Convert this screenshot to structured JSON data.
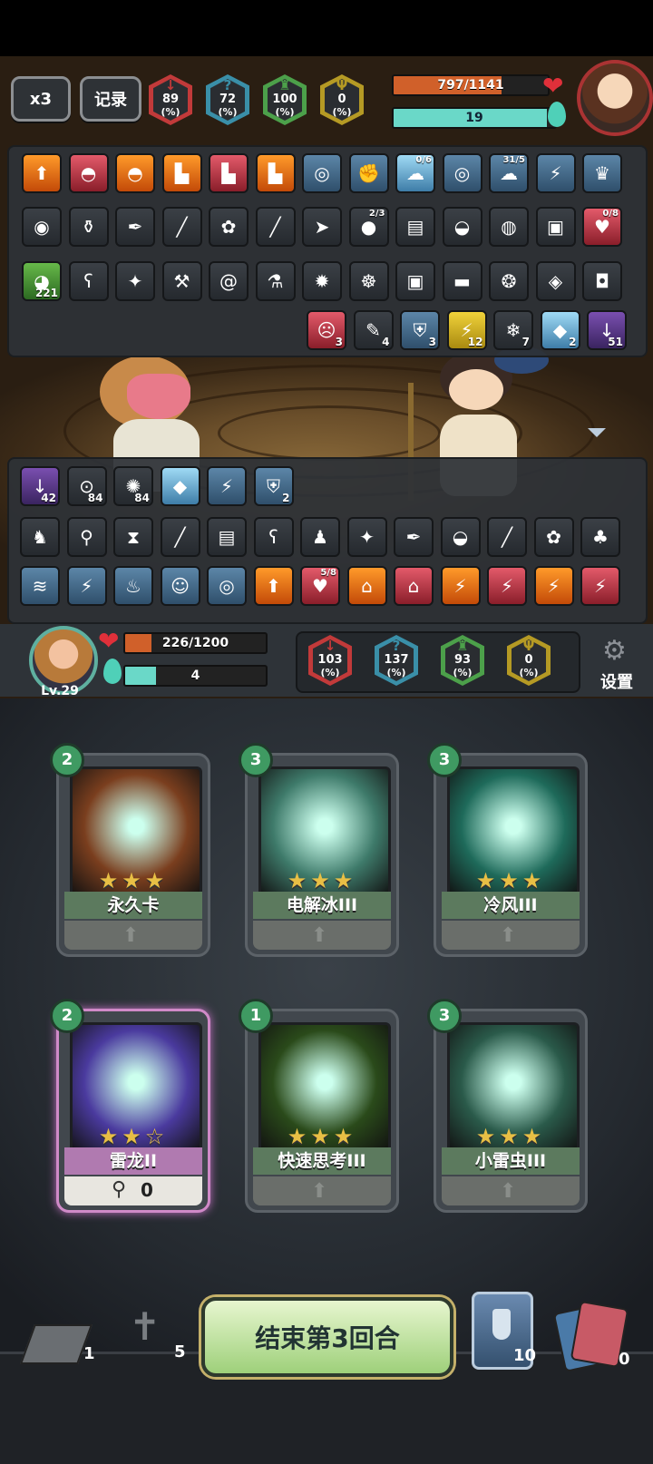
{
  "top_hud": {
    "speed": "x3",
    "record": "记录",
    "stats": [
      {
        "icon": "sword-down-icon",
        "value": "89",
        "unit": "(%)",
        "color": "#c23a3a"
      },
      {
        "icon": "question-icon",
        "value": "72",
        "unit": "(%)",
        "color": "#3a8fa8"
      },
      {
        "icon": "castle-icon",
        "value": "100",
        "unit": "(%)",
        "color": "#4ca04a"
      },
      {
        "icon": "trident-icon",
        "value": "0",
        "unit": "(%)",
        "color": "#b59a24"
      }
    ],
    "enemy_hp": "797/1141",
    "enemy_hp_fraction": 0.7,
    "enemy_energy": "19",
    "enemy_energy_fraction": 0.95
  },
  "enemy_panel": {
    "row1": [
      {
        "icon": "arrow-up-icon",
        "tone": "orange"
      },
      {
        "icon": "hat-icon",
        "tone": "red"
      },
      {
        "icon": "hat-icon",
        "tone": "orange"
      },
      {
        "icon": "boot-icon",
        "tone": "orange"
      },
      {
        "icon": "boot-icon",
        "tone": "red"
      },
      {
        "icon": "boot-icon",
        "tone": "orange"
      },
      {
        "icon": "swirl-icon",
        "tone": "blue"
      },
      {
        "icon": "muscle-icon",
        "tone": "blue"
      },
      {
        "icon": "cloud-icon",
        "tone": "ice",
        "top": "0/6"
      },
      {
        "icon": "swirl-icon",
        "tone": "blue"
      },
      {
        "icon": "cloud-icon",
        "tone": "blue",
        "top": "31/5"
      },
      {
        "icon": "lightning-icon",
        "tone": "blue"
      },
      {
        "icon": "crown-icon",
        "tone": "blue"
      }
    ],
    "row2": [
      {
        "icon": "goggles-icon",
        "tone": "dark"
      },
      {
        "icon": "bottle-icon",
        "tone": "dark"
      },
      {
        "icon": "feather-icon",
        "tone": "dark"
      },
      {
        "icon": "rod-icon",
        "tone": "dark"
      },
      {
        "icon": "creature-icon",
        "tone": "dark"
      },
      {
        "icon": "rod-icon",
        "tone": "dark"
      },
      {
        "icon": "fish-icon",
        "tone": "dark"
      },
      {
        "icon": "fruit-icon",
        "tone": "dark",
        "top": "2/3"
      },
      {
        "icon": "book-icon",
        "tone": "dark"
      },
      {
        "icon": "helmet-icon",
        "tone": "dark"
      },
      {
        "icon": "bag-icon",
        "tone": "dark"
      },
      {
        "icon": "robot-icon",
        "tone": "dark"
      },
      {
        "icon": "heart-shield-icon",
        "tone": "red",
        "top": "0/8"
      }
    ],
    "row3": [
      {
        "icon": "slime-icon",
        "tone": "green",
        "count": "221"
      },
      {
        "icon": "bear-icon",
        "tone": "dark"
      },
      {
        "icon": "beast-icon",
        "tone": "dark"
      },
      {
        "icon": "shovel-icon",
        "tone": "dark"
      },
      {
        "icon": "spiral-icon",
        "tone": "dark"
      },
      {
        "icon": "potion-icon",
        "tone": "dark"
      },
      {
        "icon": "bomb-icon",
        "tone": "dark"
      },
      {
        "icon": "ghost-icon",
        "tone": "dark"
      },
      {
        "icon": "robot-icon",
        "tone": "dark"
      },
      {
        "icon": "bread-icon",
        "tone": "dark"
      },
      {
        "icon": "wreath-icon",
        "tone": "dark"
      },
      {
        "icon": "orb-icon",
        "tone": "dark"
      },
      {
        "icon": "sack-icon",
        "tone": "dark"
      }
    ],
    "buffs": [
      {
        "icon": "angry-face-icon",
        "tone": "red",
        "count": "3"
      },
      {
        "icon": "brush-icon",
        "tone": "dark",
        "count": "4"
      },
      {
        "icon": "shield-icon",
        "tone": "blue",
        "count": "3"
      },
      {
        "icon": "lightning-icon",
        "tone": "yellow",
        "count": "12"
      },
      {
        "icon": "snowflake-icon",
        "tone": "dark",
        "count": "7"
      },
      {
        "icon": "ice-crystal-icon",
        "tone": "ice",
        "count": "2"
      },
      {
        "icon": "sword-down-icon",
        "tone": "purple",
        "count": "51"
      }
    ]
  },
  "player_panel": {
    "buffs": [
      {
        "icon": "sword-down-icon",
        "tone": "purple",
        "count": "42"
      },
      {
        "icon": "eyes-icon",
        "tone": "dark",
        "count": "84"
      },
      {
        "icon": "storm-icon",
        "tone": "dark",
        "count": "84"
      },
      {
        "icon": "ice-crystal-icon",
        "tone": "ice",
        "count": ""
      },
      {
        "icon": "lightning-icon",
        "tone": "blue",
        "count": ""
      },
      {
        "icon": "shield-icon",
        "tone": "blue",
        "count": "2"
      }
    ],
    "row2": [
      {
        "icon": "fighter-icon",
        "tone": "dark"
      },
      {
        "icon": "vial-icon",
        "tone": "dark"
      },
      {
        "icon": "hourglass-icon",
        "tone": "dark"
      },
      {
        "icon": "rod-icon",
        "tone": "dark"
      },
      {
        "icon": "book-icon",
        "tone": "dark"
      },
      {
        "icon": "bear-icon",
        "tone": "dark"
      },
      {
        "icon": "doll-icon",
        "tone": "dark"
      },
      {
        "icon": "beast-icon",
        "tone": "dark"
      },
      {
        "icon": "feather-icon",
        "tone": "dark"
      },
      {
        "icon": "helmet-icon",
        "tone": "dark"
      },
      {
        "icon": "rod-icon",
        "tone": "dark"
      },
      {
        "icon": "creature-icon",
        "tone": "dark"
      },
      {
        "icon": "plant-icon",
        "tone": "dark"
      }
    ],
    "row3": [
      {
        "icon": "wind-icon",
        "tone": "blue"
      },
      {
        "icon": "lightning-icon",
        "tone": "blue"
      },
      {
        "icon": "pig-icon",
        "tone": "blue"
      },
      {
        "icon": "face-icon",
        "tone": "blue"
      },
      {
        "icon": "swirl-icon",
        "tone": "blue"
      },
      {
        "icon": "arrow-up-icon",
        "tone": "orange"
      },
      {
        "icon": "heart-shield-icon",
        "tone": "red",
        "top": "5/8"
      },
      {
        "icon": "shirt-icon",
        "tone": "orange"
      },
      {
        "icon": "shirt-icon",
        "tone": "red"
      },
      {
        "icon": "lightning-icon",
        "tone": "orange"
      },
      {
        "icon": "lightning-icon",
        "tone": "red"
      },
      {
        "icon": "lightning-icon",
        "tone": "orange"
      },
      {
        "icon": "lightning-icon",
        "tone": "red"
      }
    ]
  },
  "player_hud": {
    "level": "Lv.29",
    "hp": "226/1200",
    "hp_fraction": 0.19,
    "energy": "4",
    "energy_fraction": 0.22,
    "stats": [
      {
        "icon": "sword-down-icon",
        "value": "103",
        "unit": "(%)",
        "color": "#c23a3a"
      },
      {
        "icon": "question-icon",
        "value": "137",
        "unit": "(%)",
        "color": "#3a8fa8"
      },
      {
        "icon": "castle-icon",
        "value": "93",
        "unit": "(%)",
        "color": "#4ca04a"
      },
      {
        "icon": "trident-icon",
        "value": "0",
        "unit": "(%)",
        "color": "#b59a24"
      }
    ],
    "settings": "设置"
  },
  "cards": [
    {
      "cost": "2",
      "name": "永久卡",
      "stars": "★★★",
      "art": "#7a3e1e",
      "name_bg": "#5c7a5e",
      "footer": ""
    },
    {
      "cost": "3",
      "name": "电解冰III",
      "stars": "★★★",
      "art": "#3e7a6a",
      "name_bg": "#5c7a5e",
      "footer": ""
    },
    {
      "cost": "3",
      "name": "冷风III",
      "stars": "★★★",
      "art": "#1e6a5a",
      "name_bg": "#5c7a5e",
      "footer": ""
    },
    {
      "cost": "2",
      "name": "雷龙II",
      "stars": "★★☆",
      "art": "#4a3a9e",
      "name_bg": "#b07ab0",
      "footer": "0"
    },
    {
      "cost": "1",
      "name": "快速思考III",
      "stars": "★★★",
      "art": "#2a4a1a",
      "name_bg": "#5c7a5e",
      "footer": ""
    },
    {
      "cost": "3",
      "name": "小雷虫III",
      "stars": "★★★",
      "art": "#2a5a4a",
      "name_bg": "#5c7a5e",
      "footer": ""
    }
  ],
  "bottom": {
    "deck_count": "1",
    "grave_count": "5",
    "end_turn": "结束第3回合",
    "potion_count": "10",
    "discard_count": "0"
  }
}
